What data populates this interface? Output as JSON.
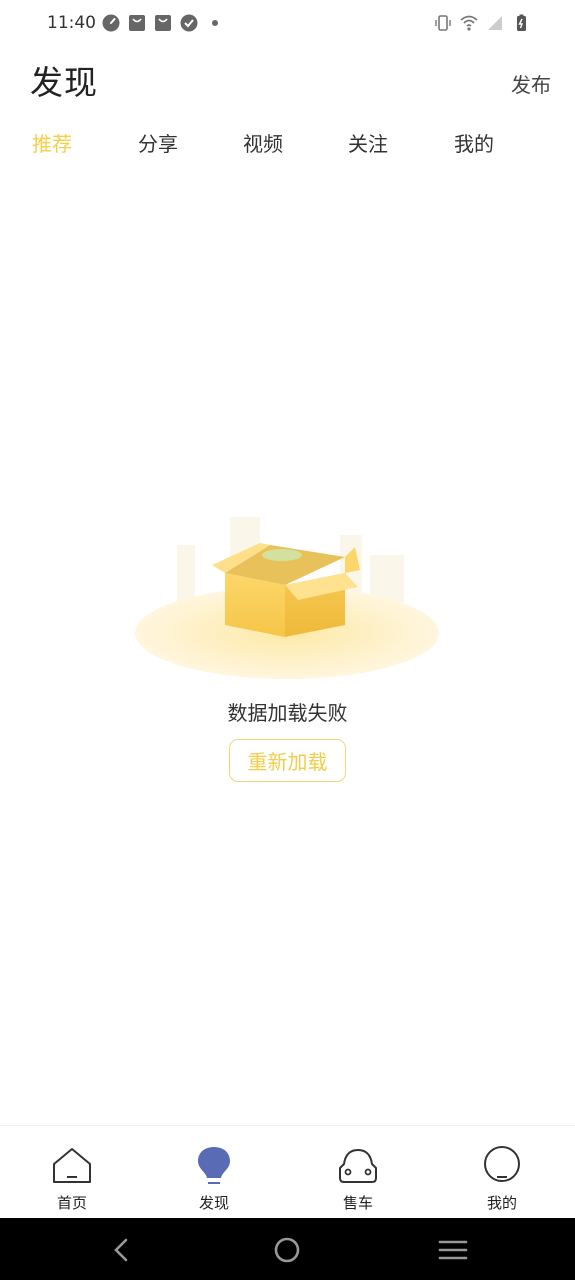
{
  "status_bar": {
    "time": "11:40",
    "left_icons": [
      "speedometer-icon",
      "bag-icon",
      "bag-icon",
      "check-circle-icon",
      "dot-icon"
    ],
    "right_icons": [
      "vibrate-icon",
      "wifi-icon",
      "signal-icon",
      "battery-charging-icon"
    ]
  },
  "header": {
    "title": "发现",
    "publish_label": "发布"
  },
  "tabs": [
    {
      "label": "推荐",
      "active": true
    },
    {
      "label": "分享",
      "active": false
    },
    {
      "label": "视频",
      "active": false
    },
    {
      "label": "关注",
      "active": false
    },
    {
      "label": "我的",
      "active": false
    }
  ],
  "empty_state": {
    "message": "数据加载失败",
    "reload_label": "重新加载",
    "illustration": "open-box-illustration"
  },
  "bottom_nav": [
    {
      "label": "首页",
      "icon": "home-icon",
      "active": false
    },
    {
      "label": "发现",
      "icon": "lightbulb-icon",
      "active": true
    },
    {
      "label": "售车",
      "icon": "car-icon",
      "active": false
    },
    {
      "label": "我的",
      "icon": "profile-icon",
      "active": false
    }
  ],
  "system_nav": [
    "back-icon",
    "home-circle-icon",
    "menu-icon"
  ],
  "colors": {
    "accent": "#f5cf4a",
    "nav_active": "#5a6bb5",
    "text": "#222222"
  }
}
